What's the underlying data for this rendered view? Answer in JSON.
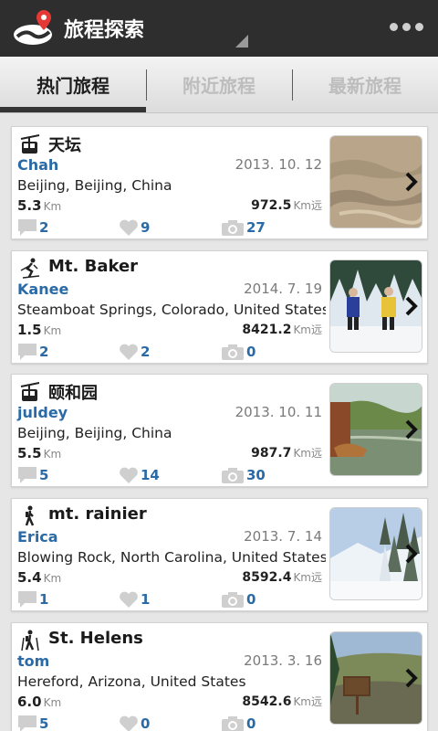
{
  "app": {
    "title": "旅程探索",
    "logo_icon": "location-pin-logo-icon",
    "overflow_icon": "overflow-menu-icon"
  },
  "tabs": [
    {
      "label": "热门旅程",
      "active": true
    },
    {
      "label": "附近旅程",
      "active": false
    },
    {
      "label": "最新旅程",
      "active": false
    }
  ],
  "trips": [
    {
      "type_icon": "cable-car-icon",
      "title": "天坛",
      "user": "Chah",
      "date": "2013. 10. 12",
      "location": "Beijing, Beijing, China",
      "distance": "5.3",
      "distance_unit": "Km",
      "far": "972.5",
      "far_unit": "Km远",
      "comments": "2",
      "likes": "9",
      "photos": "27",
      "thumb": "stone-path-photo"
    },
    {
      "type_icon": "skier-icon",
      "title": "Mt. Baker",
      "user": "Kanee",
      "date": "2014. 7. 19",
      "location": "Steamboat Springs, Colorado, United States",
      "distance": "1.5",
      "distance_unit": "Km",
      "far": "8421.2",
      "far_unit": "Km远",
      "comments": "2",
      "likes": "2",
      "photos": "0",
      "thumb": "snowshoers-photo"
    },
    {
      "type_icon": "cable-car-icon",
      "title": "颐和园",
      "user": "juldey",
      "date": "2013. 10. 11",
      "location": "Beijing, Beijing, China",
      "distance": "5.5",
      "distance_unit": "Km",
      "far": "987.7",
      "far_unit": "Km远",
      "comments": "5",
      "likes": "14",
      "photos": "30",
      "thumb": "summer-palace-lake-photo"
    },
    {
      "type_icon": "hiker-icon",
      "title": "mt. rainier",
      "user": "Erica",
      "date": "2013. 7. 14",
      "location": "Blowing Rock, North Carolina, United States",
      "distance": "5.4",
      "distance_unit": "Km",
      "far": "8592.4",
      "far_unit": "Km远",
      "comments": "1",
      "likes": "1",
      "photos": "0",
      "thumb": "snowy-forest-photo"
    },
    {
      "type_icon": "trekker-poles-icon",
      "title": "St. Helens",
      "user": "tom",
      "date": "2013. 3. 16",
      "location": "Hereford, Arizona, United States",
      "distance": "6.0",
      "distance_unit": "Km",
      "far": "8542.6",
      "far_unit": "Km远",
      "comments": "5",
      "likes": "0",
      "photos": "0",
      "thumb": "trail-sign-photo"
    }
  ],
  "colors": {
    "actionbar": "#2e2e2e",
    "link_blue": "#2a6aa6",
    "tab_active": "#1f1f1f",
    "tab_inactive": "#bdbdbd"
  }
}
